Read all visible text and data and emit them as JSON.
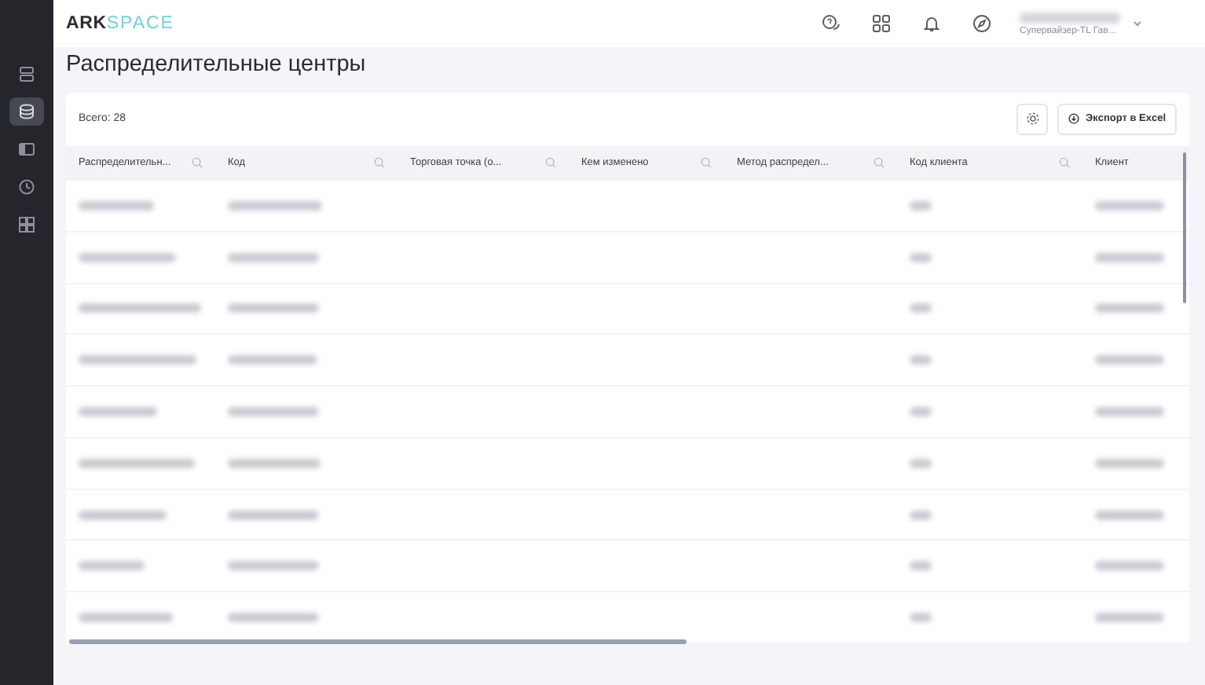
{
  "sidebar": {
    "items": [
      {
        "selected": false
      },
      {
        "selected": true
      },
      {
        "selected": false
      },
      {
        "selected": false
      },
      {
        "selected": false
      }
    ]
  },
  "header": {
    "logo": {
      "bold": "ARK",
      "light": "SPACE"
    },
    "user": {
      "role": "Супервайзер-TL Гав..."
    }
  },
  "page": {
    "title": "Распределительные центры"
  },
  "toolbar": {
    "total": "Всего: 28",
    "export_button": "Экспорт в Excel"
  },
  "table": {
    "columns": [
      {
        "label": "Распределительн...",
        "filter": true
      },
      {
        "label": "Код",
        "filter": true
      },
      {
        "label": "Торговая точка (о...",
        "filter": true
      },
      {
        "label": "Кем изменено",
        "filter": true
      },
      {
        "label": "Метод распредел...",
        "filter": true
      },
      {
        "label": "Код клиента",
        "filter": true
      },
      {
        "label": "Клиент",
        "filter": false
      }
    ]
  }
}
